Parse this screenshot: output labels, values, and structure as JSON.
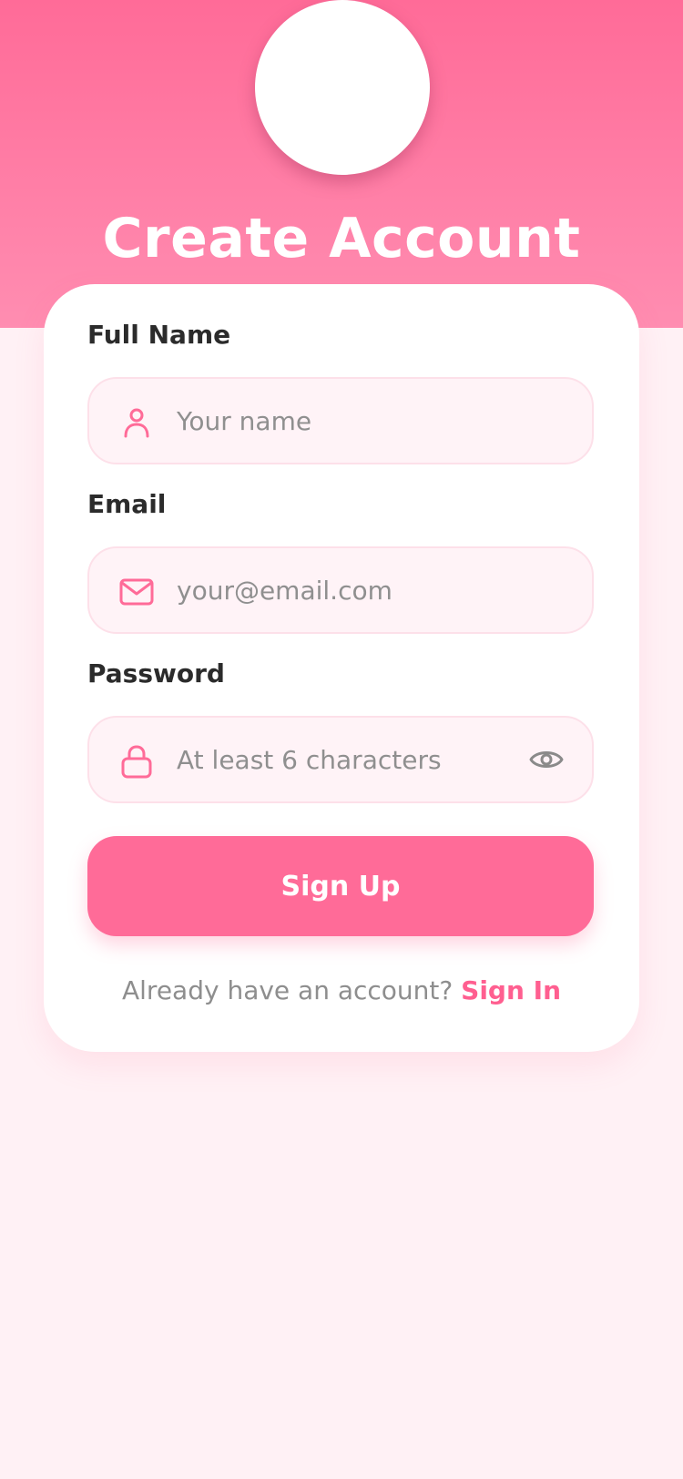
{
  "header": {
    "title": "Create Account"
  },
  "form": {
    "full_name": {
      "label": "Full Name",
      "placeholder": "Your name",
      "value": "",
      "icon": "user-icon"
    },
    "email": {
      "label": "Email",
      "placeholder": "your@email.com",
      "value": "",
      "icon": "mail-icon"
    },
    "password": {
      "label": "Password",
      "placeholder": "At least 6 characters",
      "value": "",
      "icon": "lock-icon",
      "toggle_icon": "eye-icon"
    },
    "submit_label": "Sign Up"
  },
  "footer": {
    "prompt": "Already have an account?",
    "link_label": "Sign In"
  },
  "colors": {
    "primary": "#ff6b98",
    "header_gradient_top": "#ff6b98",
    "header_gradient_bottom": "#ff8db1",
    "page_background": "#fff1f5",
    "input_background": "#fff3f7",
    "input_border": "#fde0e9",
    "label_text": "#2b2b2b",
    "placeholder_text": "#8f8f8f",
    "link": "#ff5f90"
  }
}
